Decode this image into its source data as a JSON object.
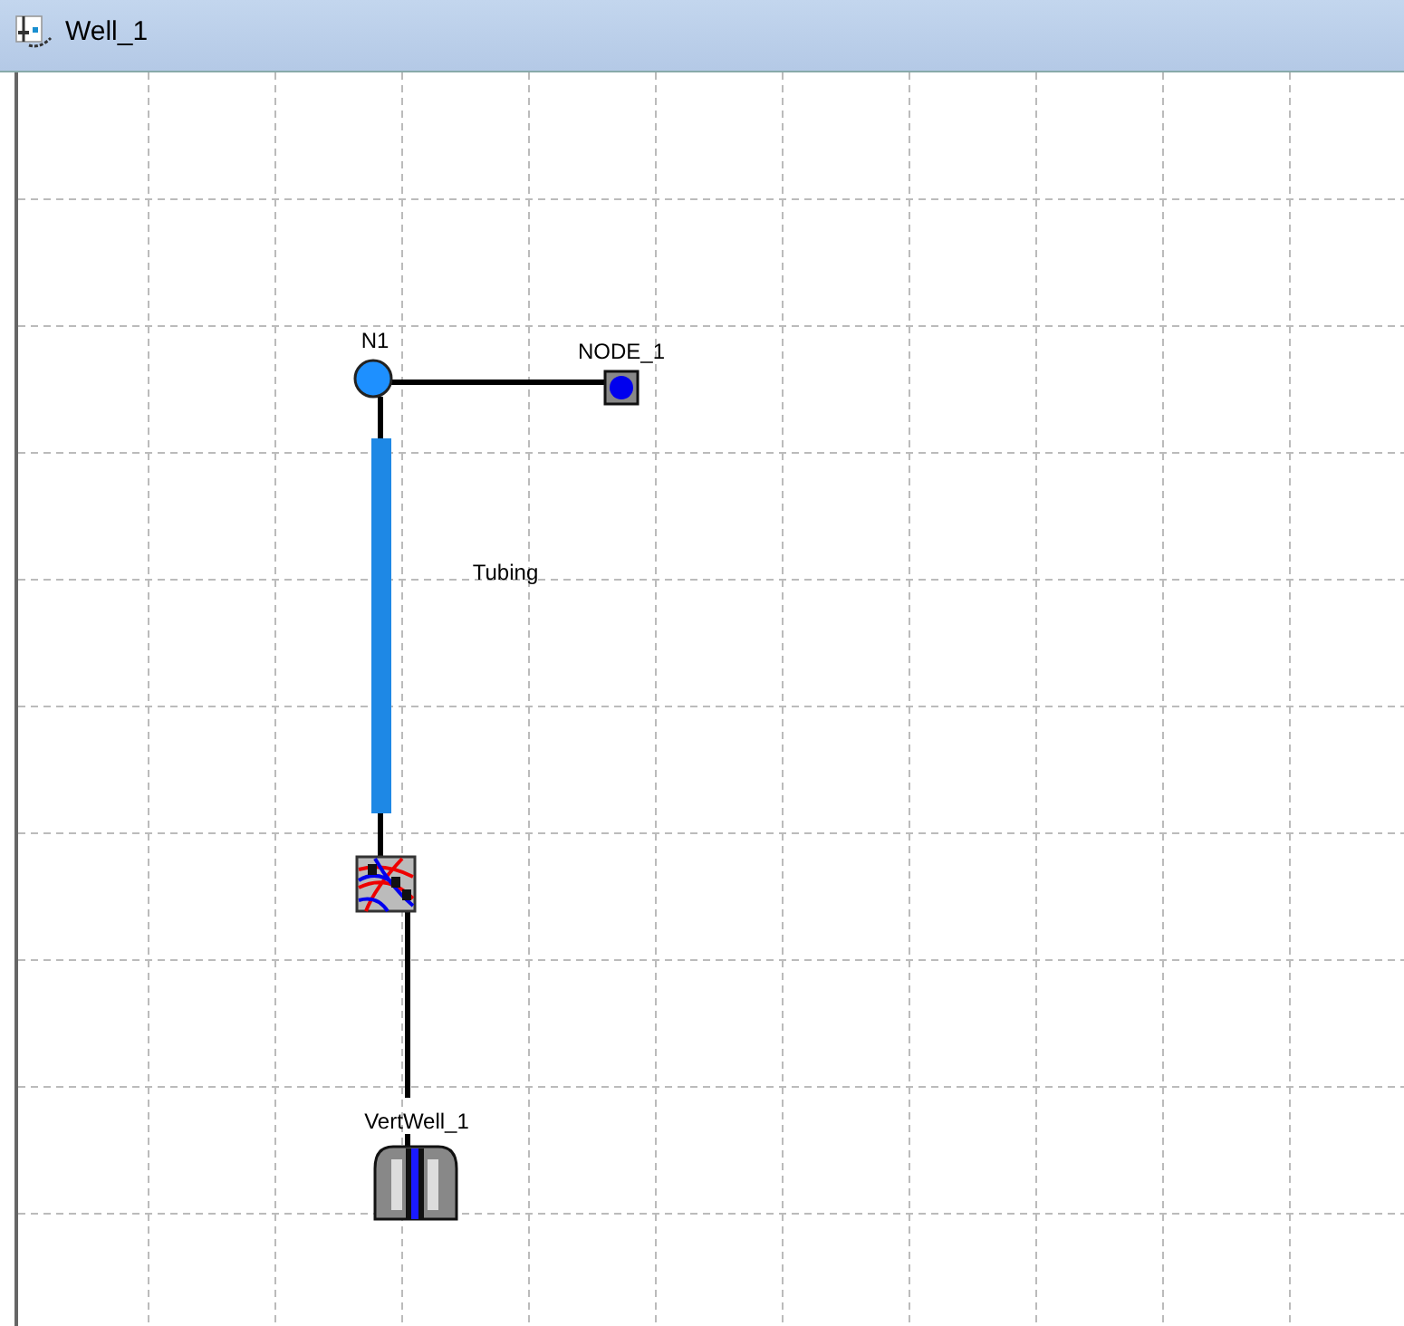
{
  "window": {
    "title": "Well_1"
  },
  "nodes": [
    {
      "kind": "junction",
      "label": "N1"
    },
    {
      "kind": "sink",
      "label": "NODE_1"
    },
    {
      "kind": "tubing",
      "label": "Tubing"
    },
    {
      "kind": "completion"
    },
    {
      "kind": "well",
      "label": "VertWell_1"
    }
  ]
}
